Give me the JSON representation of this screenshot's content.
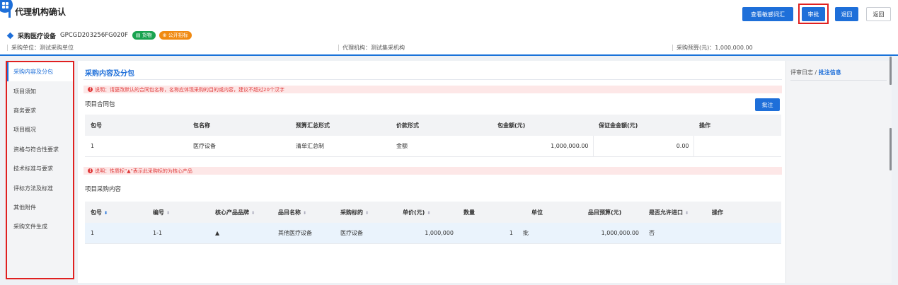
{
  "header": {
    "title": "代理机构确认",
    "buttons": {
      "sensitive_words": "查看敏感词汇",
      "approve": "审批",
      "reject": "退回",
      "back": "返回"
    }
  },
  "project": {
    "name": "采购医疗设备",
    "code": "GPCGD203256FG020F",
    "tags": [
      "货物",
      "公开招标"
    ],
    "info": {
      "purchaser": "采购单位：测试采购单位",
      "agency": "代理机构：测试集采机构",
      "budget": "采购预算(元)：1,000,000.00"
    }
  },
  "sidebar": {
    "items": [
      {
        "label": "采购内容及分包",
        "active": true
      },
      {
        "label": "项目须知"
      },
      {
        "label": "商务要求"
      },
      {
        "label": "项目概况"
      },
      {
        "label": "资格与符合性要求"
      },
      {
        "label": "技术标准与要求"
      },
      {
        "label": "评标方法及标准"
      },
      {
        "label": "其他附件"
      },
      {
        "label": "采购文件生成"
      }
    ]
  },
  "main": {
    "section_title": "采购内容及分包",
    "notice1": "说明：请更改默认的合同包名称，名称应体现采购的目的或内容，建议不超过20个汉字",
    "contract_block_title": "项目合同包",
    "batch_button": "批注",
    "contract_table": {
      "headers": [
        "包号",
        "包名称",
        "预算汇总形式",
        "价款形式",
        "包金额(元)",
        "保证金金额(元)",
        "操作"
      ],
      "rows": [
        [
          "1",
          "医疗设备",
          "清单汇总制",
          "金额",
          "1,000,000.00",
          "0.00",
          ""
        ]
      ]
    },
    "notice2": "说明：性质标\"▲\"表示此采购标的为核心产品",
    "purchase_block_title": "项目采购内容",
    "purchase_table": {
      "headers": [
        "包号",
        "编号",
        "核心产品品牌",
        "品目名称",
        "采购标的",
        "单价(元)",
        "数量",
        "单位",
        "品目预算(元)",
        "是否允许进口",
        "操作"
      ],
      "rows": [
        [
          "1",
          "1-1",
          "▲",
          "其他医疗设备",
          "医疗设备",
          "1,000,000",
          "1",
          "批",
          "1,000,000.00",
          "否",
          ""
        ]
      ]
    }
  },
  "right_panel": {
    "log_label": "评审日志 /",
    "annotation_label": "批注信息"
  },
  "colors": {
    "primary": "#1e6fd9",
    "highlight_border": "#e02020",
    "tag_green": "#19a350",
    "tag_orange": "#f08a12"
  }
}
